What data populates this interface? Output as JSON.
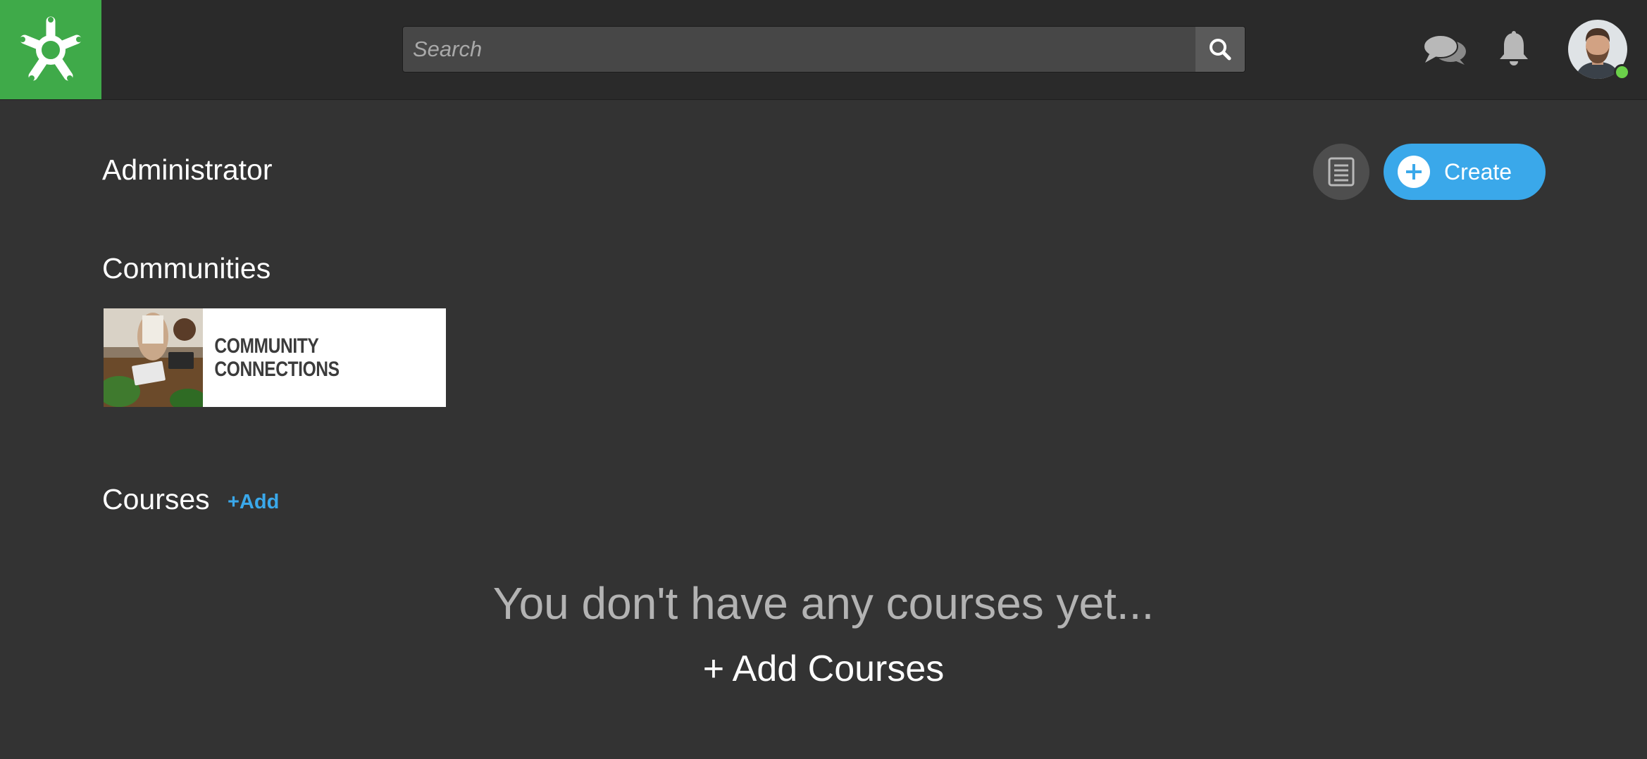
{
  "header": {
    "logo_icon": "asterisk-star-logo",
    "logo_color": "#3faa49",
    "search": {
      "placeholder": "Search",
      "value": ""
    },
    "icons": [
      "search-icon",
      "chat-icon",
      "bell-icon"
    ],
    "avatar_status": "online"
  },
  "main": {
    "page_title": "Administrator",
    "create_button": {
      "label": "Create",
      "color": "#3aa8ea"
    },
    "list_button_icon": "list-icon",
    "communities": {
      "heading": "Communities",
      "items": [
        {
          "line1": "COMMUNITY",
          "line2": "CONNECTIONS"
        }
      ]
    },
    "courses": {
      "heading": "Courses",
      "add_label": "+Add",
      "empty_message": "You don't have any courses yet...",
      "add_courses_label": "+ Add Courses"
    }
  }
}
